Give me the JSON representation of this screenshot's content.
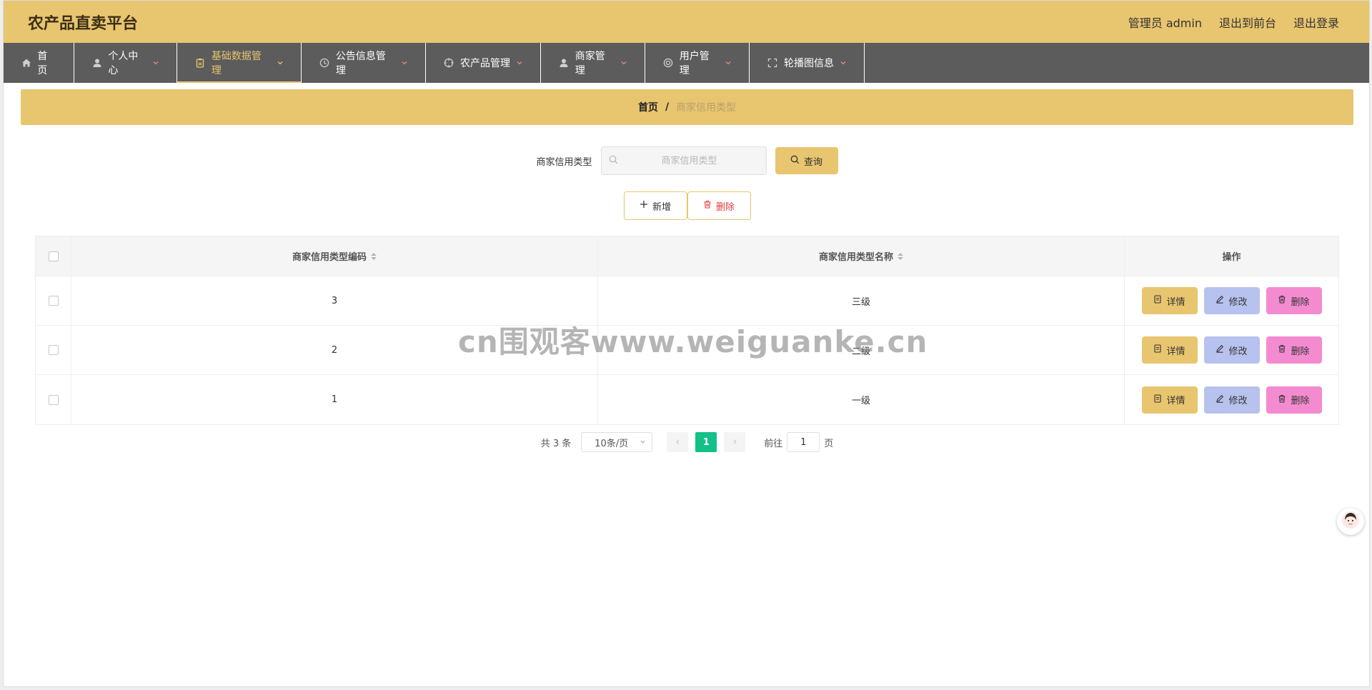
{
  "header": {
    "title": "农产品直卖平台",
    "user_label": "管理员 admin",
    "front_link": "退出到前台",
    "logout_link": "退出登录"
  },
  "nav": [
    {
      "label": "首页",
      "icon": "home-icon",
      "has_caret": false
    },
    {
      "label": "个人中心",
      "icon": "user-icon",
      "has_caret": true
    },
    {
      "label": "基础数据管理",
      "icon": "clipboard-icon",
      "has_caret": true,
      "active": true
    },
    {
      "label": "公告信息管理",
      "icon": "clock-icon",
      "has_caret": true
    },
    {
      "label": "农产品管理",
      "icon": "target-icon",
      "has_caret": true
    },
    {
      "label": "商家管理",
      "icon": "person-icon",
      "has_caret": true
    },
    {
      "label": "用户管理",
      "icon": "lifebuoy-icon",
      "has_caret": true
    },
    {
      "label": "轮播图信息",
      "icon": "fullscreen-icon",
      "has_caret": true
    }
  ],
  "breadcrumb": {
    "home": "首页",
    "separator": "/",
    "current": "商家信用类型"
  },
  "search": {
    "label": "商家信用类型",
    "placeholder": "商家信用类型",
    "value": "",
    "button": "查询"
  },
  "actions": {
    "add": "新增",
    "delete": "删除"
  },
  "table": {
    "columns": [
      "商家信用类型编码",
      "商家信用类型名称",
      "操作"
    ],
    "rows": [
      {
        "code": "3",
        "name": "三级"
      },
      {
        "code": "2",
        "name": "二级"
      },
      {
        "code": "1",
        "name": "一级"
      }
    ],
    "row_buttons": {
      "detail": "详情",
      "edit": "修改",
      "delete": "删除"
    }
  },
  "pagination": {
    "total": "共 3 条",
    "page_size": "10条/页",
    "current_page": "1",
    "goto_prefix": "前往",
    "goto_value": "1",
    "goto_suffix": "页"
  },
  "watermark": "cn围观客www.weiguanke.cn",
  "colors": {
    "accent": "#e8c56f",
    "nav_bg": "#5c5c5c",
    "page_active": "#13c087",
    "edit_btn": "#b8c2ee",
    "delete_btn": "#f48bd0",
    "danger_text": "#e63b3b"
  }
}
